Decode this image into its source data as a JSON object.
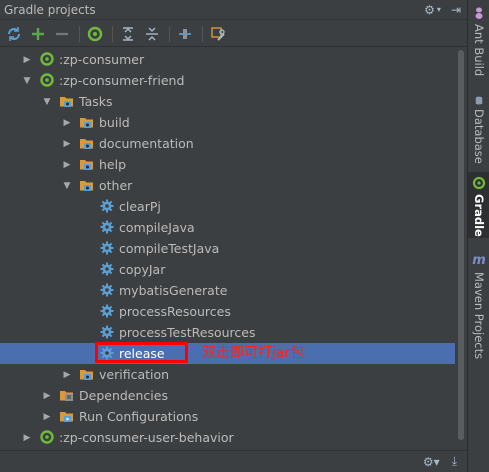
{
  "panel": {
    "title": "Gradle projects"
  },
  "toolbar": {
    "buttons": [
      {
        "icon": "refresh-all-icon"
      },
      {
        "icon": "add-icon"
      },
      {
        "icon": "remove-icon"
      },
      {
        "icon": "gradle-execute-icon"
      },
      {
        "icon": "expand-all-icon"
      },
      {
        "icon": "collapse-all-icon"
      },
      {
        "icon": "toggle-offline-icon"
      },
      {
        "icon": "gradle-settings-icon"
      }
    ]
  },
  "tree": {
    "rows": [
      {
        "label": ":zp-consumer",
        "depth": 0,
        "arrow": "collapsed",
        "icon": "gradle-project-icon"
      },
      {
        "label": ":zp-consumer-friend",
        "depth": 0,
        "arrow": "expanded",
        "icon": "gradle-project-icon"
      },
      {
        "label": "Tasks",
        "depth": 1,
        "arrow": "expanded",
        "icon": "tasks-folder-icon"
      },
      {
        "label": "build",
        "depth": 2,
        "arrow": "collapsed",
        "icon": "tasks-folder-icon"
      },
      {
        "label": "documentation",
        "depth": 2,
        "arrow": "collapsed",
        "icon": "tasks-folder-icon"
      },
      {
        "label": "help",
        "depth": 2,
        "arrow": "collapsed",
        "icon": "tasks-folder-icon"
      },
      {
        "label": "other",
        "depth": 2,
        "arrow": "expanded",
        "icon": "tasks-folder-icon"
      },
      {
        "label": "clearPj",
        "depth": 3,
        "arrow": "none",
        "icon": "gear-task-icon"
      },
      {
        "label": "compileJava",
        "depth": 3,
        "arrow": "none",
        "icon": "gear-task-icon"
      },
      {
        "label": "compileTestJava",
        "depth": 3,
        "arrow": "none",
        "icon": "gear-task-icon"
      },
      {
        "label": "copyJar",
        "depth": 3,
        "arrow": "none",
        "icon": "gear-task-icon"
      },
      {
        "label": "mybatisGenerate",
        "depth": 3,
        "arrow": "none",
        "icon": "gear-task-icon"
      },
      {
        "label": "processResources",
        "depth": 3,
        "arrow": "none",
        "icon": "gear-task-icon"
      },
      {
        "label": "processTestResources",
        "depth": 3,
        "arrow": "none",
        "icon": "gear-task-icon"
      },
      {
        "label": "release",
        "depth": 3,
        "arrow": "none",
        "icon": "gear-task-icon",
        "selected": true
      },
      {
        "label": "verification",
        "depth": 2,
        "arrow": "collapsed",
        "icon": "tasks-folder-icon"
      },
      {
        "label": "Dependencies",
        "depth": 1,
        "arrow": "collapsed",
        "icon": "dependencies-icon"
      },
      {
        "label": "Run Configurations",
        "depth": 1,
        "arrow": "collapsed",
        "icon": "run-configurations-icon"
      },
      {
        "label": ":zp-consumer-user-behavior",
        "depth": 0,
        "arrow": "collapsed",
        "icon": "gradle-project-icon"
      }
    ]
  },
  "annotation": {
    "text": "双击即可打jar包"
  },
  "sidebar": {
    "tabs": [
      {
        "label": "Ant Build",
        "icon": "ant-icon",
        "active": false
      },
      {
        "label": "Database",
        "icon": "database-icon",
        "active": false
      },
      {
        "label": "Gradle",
        "icon": "gradle-icon",
        "active": true
      },
      {
        "label": "Maven Projects",
        "icon": "maven-icon",
        "active": false
      }
    ]
  },
  "colors": {
    "background": "#3c3f41",
    "selection": "#4b6eaf",
    "highlight_box": "#ff0000",
    "annotation_text": "#ff2020",
    "gradle_green": "#6fba3a",
    "task_gear_blue": "#5a9fd4",
    "folder_orange": "#d89a3c"
  }
}
